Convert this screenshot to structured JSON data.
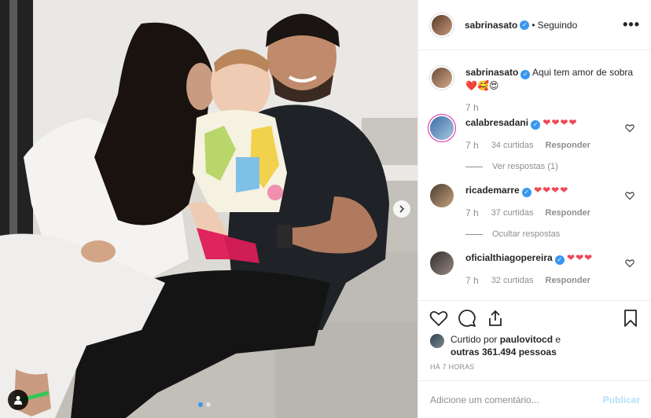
{
  "header": {
    "username": "sabrinasato",
    "separator": "•",
    "follow_status": "Seguindo",
    "more": "•••"
  },
  "caption": {
    "username": "sabrinasato",
    "text": "Aqui tem amor de sobra",
    "emoji": "❤️🥰😍",
    "time": "7 h"
  },
  "comments": [
    {
      "username": "calabresadani",
      "text": "❤❤❤❤",
      "time": "7 h",
      "likes": "34 curtidas",
      "reply": "Responder",
      "replies_toggle": "Ver respostas (1)"
    },
    {
      "username": "ricademarre",
      "text": "❤❤❤❤",
      "time": "7 h",
      "likes": "37 curtidas",
      "reply": "Responder",
      "replies_toggle": "Ocultar respostas"
    },
    {
      "username": "oficialthiagopereira",
      "text": "❤❤❤",
      "time": "7 h",
      "likes": "32 curtidas",
      "reply": "Responder"
    }
  ],
  "likes": {
    "prefix": "Curtido por",
    "liker": "paulovitocd",
    "conj": "e",
    "others": "outras 361.494 pessoas"
  },
  "time_ago": "HÁ 7 HORAS",
  "add_comment": {
    "placeholder": "Adicione um comentário...",
    "publish": "Publicar"
  },
  "carousel": {
    "slides": 2,
    "current": 1
  },
  "icons": {
    "verified": "✓",
    "actions": [
      "heart-icon",
      "comment-icon",
      "share-icon",
      "bookmark-icon"
    ],
    "tag": "user-tag-icon",
    "next": "chevron-right-icon"
  },
  "colors": {
    "verified": "#3897f0",
    "heart": "#ed4956",
    "publish_disabled": "#b2dffc",
    "muted": "#8e8e8e"
  }
}
